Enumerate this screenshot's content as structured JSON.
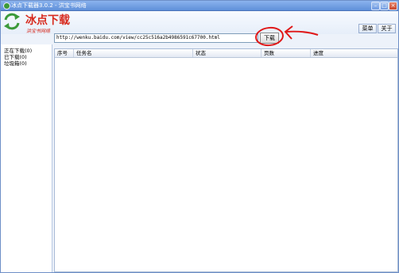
{
  "window": {
    "title": "冰点下载器3.0.2 - 洪宝书网络"
  },
  "header": {
    "logo_text": "冰点下载",
    "logo_subtext": "洪宝书网络"
  },
  "menu": {
    "menu_label": "菜单",
    "about_label": "关于"
  },
  "toolbar": {
    "url_value": "http://wenku.baidu.com/view/cc25c516a2b4986591c67700.html",
    "download_label": "下载"
  },
  "sidebar": {
    "items": [
      {
        "label": "正在下载(0)"
      },
      {
        "label": "已下载(0)"
      },
      {
        "label": "垃圾箱(0)"
      }
    ]
  },
  "table": {
    "columns": [
      {
        "label": "序号"
      },
      {
        "label": "任务名"
      },
      {
        "label": "状态"
      },
      {
        "label": "页数"
      },
      {
        "label": "进度"
      }
    ],
    "rows": []
  },
  "colors": {
    "annotation": "#e01818",
    "logo_red": "#d72a1e",
    "logo_green": "#3c9a3a"
  }
}
